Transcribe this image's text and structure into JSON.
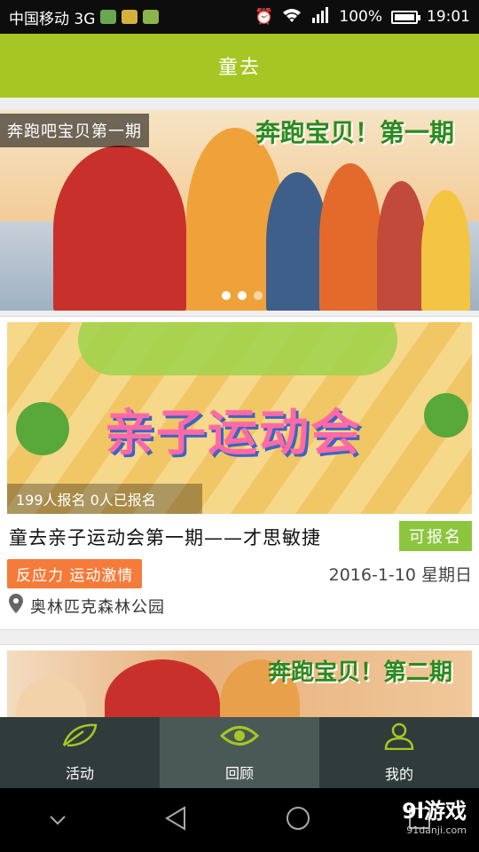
{
  "status_bar": {
    "carrier": "中国移动 3G",
    "battery": "100%",
    "time": "19:01"
  },
  "header": {
    "title": "童去"
  },
  "banner": {
    "label": "奔跑吧宝贝第一期",
    "deco_text": "奔跑宝贝！第一期"
  },
  "activities": [
    {
      "image_text": "亲子运动会",
      "image_strip": "199人报名 0人已报名",
      "title": "童去亲子运动会第一期——才思敏捷",
      "status": "可报名",
      "tags": "反应力 运动激情",
      "date": "2016-1-10 星期日",
      "location": "奥林匹克森林公园"
    },
    {
      "deco_text": "奔跑宝贝！第二期"
    }
  ],
  "tabs": [
    {
      "label": "活动",
      "icon": "leaf-icon"
    },
    {
      "label": "回顾",
      "icon": "eye-icon"
    },
    {
      "label": "我的",
      "icon": "user-icon"
    }
  ],
  "colors": {
    "brand_green": "#a5c623",
    "tag_orange": "#f57b3a",
    "status_green": "#8cc63f",
    "tab_bg": "#2f3c3b"
  },
  "watermark": {
    "brand": "9l游戏",
    "domain": "91danji.com"
  }
}
